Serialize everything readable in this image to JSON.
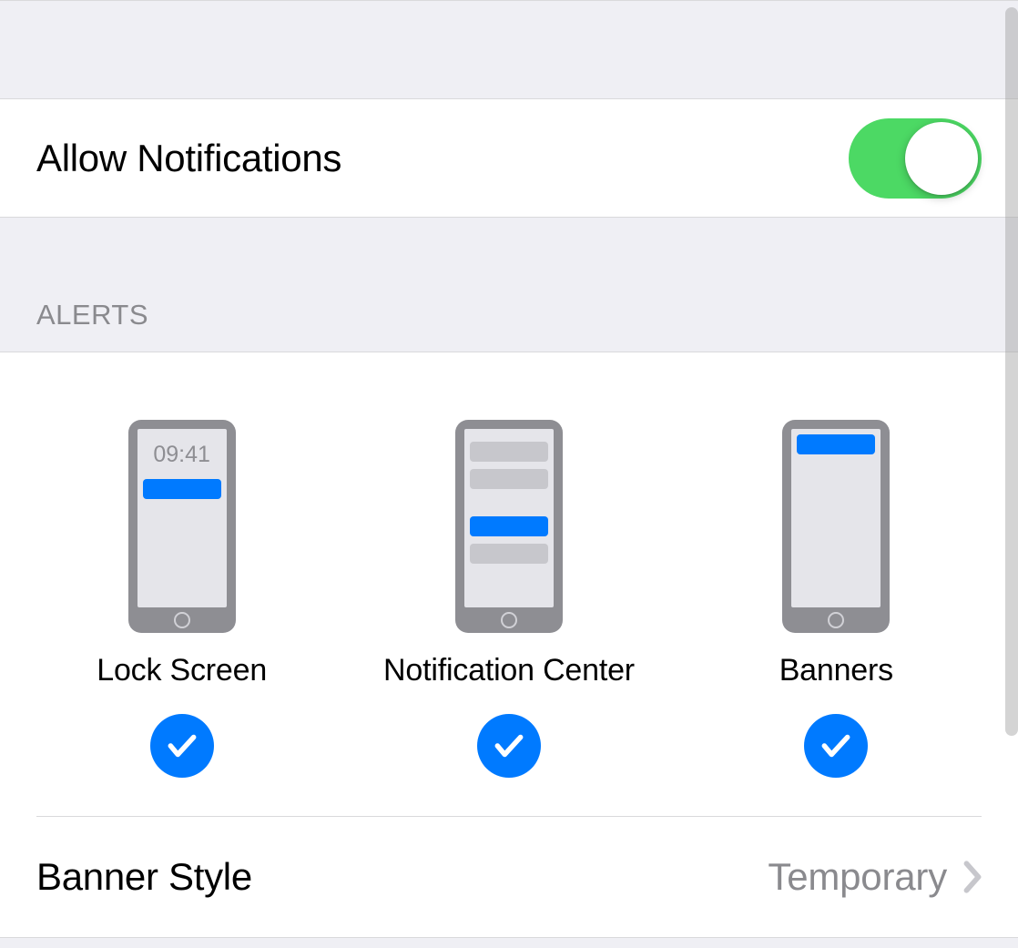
{
  "allow_notifications": {
    "label": "Allow Notifications",
    "enabled": true
  },
  "sections": {
    "alerts_header": "ALERTS"
  },
  "alerts": {
    "lock_screen": {
      "label": "Lock Screen",
      "time": "09:41",
      "checked": true
    },
    "notification_center": {
      "label": "Notification Center",
      "checked": true
    },
    "banners": {
      "label": "Banners",
      "checked": true
    }
  },
  "banner_style": {
    "label": "Banner Style",
    "value": "Temporary"
  },
  "colors": {
    "accent": "#007aff",
    "toggle_on": "#4cd964"
  }
}
